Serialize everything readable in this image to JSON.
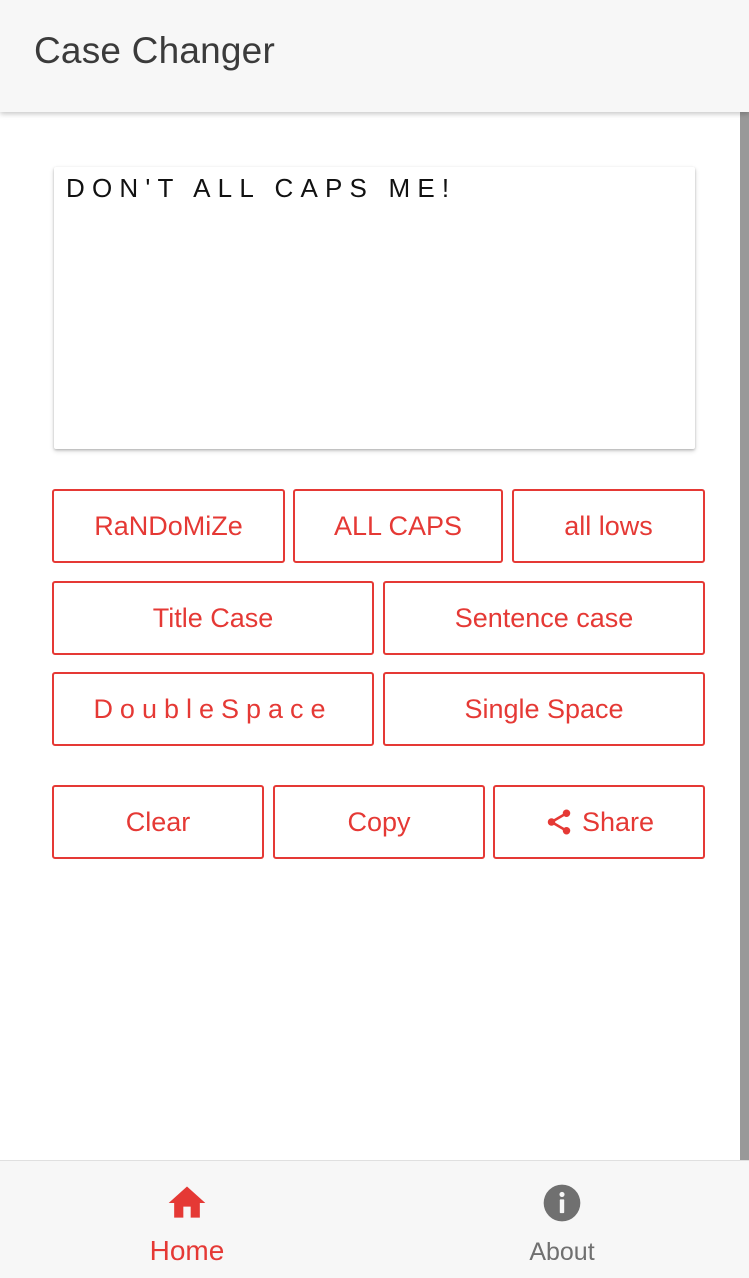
{
  "app_bar": {
    "title": "Case Changer"
  },
  "editor": {
    "value": "DON'T ALL CAPS ME!"
  },
  "buttons": {
    "randomize": "RaNDoMiZe",
    "all_caps": "ALL CAPS",
    "all_lows": "all lows",
    "title_case": "Title Case",
    "sentence_case": "Sentence case",
    "double_space": "DoubleSpace",
    "single_space": "Single Space",
    "clear": "Clear",
    "copy": "Copy",
    "share": "Share",
    "share_icon": "share-icon"
  },
  "bottom_nav": {
    "home": {
      "label": "Home",
      "icon": "home-icon",
      "active": true
    },
    "about": {
      "label": "About",
      "icon": "info-icon",
      "active": false
    }
  },
  "colors": {
    "accent": "#e53935",
    "title_text": "#3b3b3b",
    "inactive_nav": "#707070",
    "bar_background": "#f7f7f7"
  }
}
